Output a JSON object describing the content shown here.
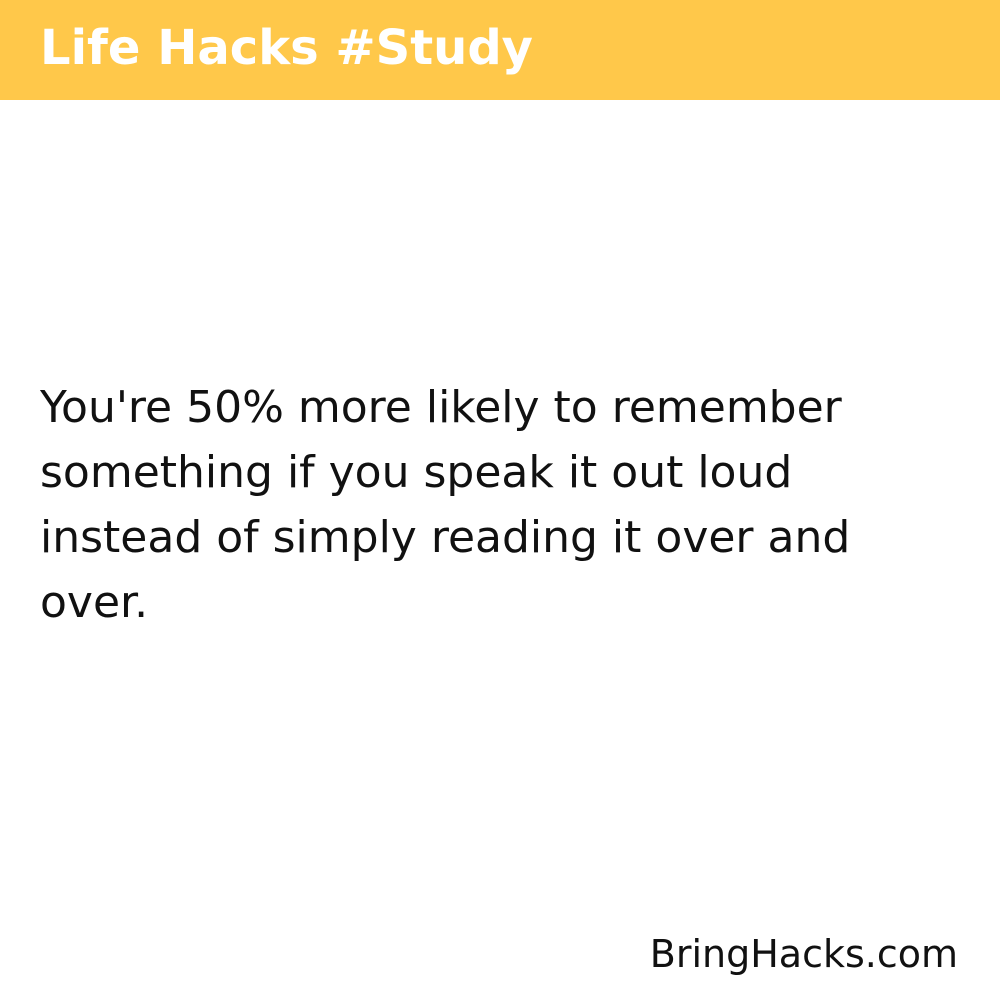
{
  "header": {
    "title": "Life Hacks #Study"
  },
  "content": {
    "hack_text": "You're 50% more likely to remember something if you speak it out loud instead of simply reading it over and over."
  },
  "footer": {
    "brand": "BringHacks.com"
  },
  "colors": {
    "header_background": "#ffc84a",
    "header_text": "#ffffff",
    "body_text": "#111111",
    "page_background": "#ffffff"
  }
}
